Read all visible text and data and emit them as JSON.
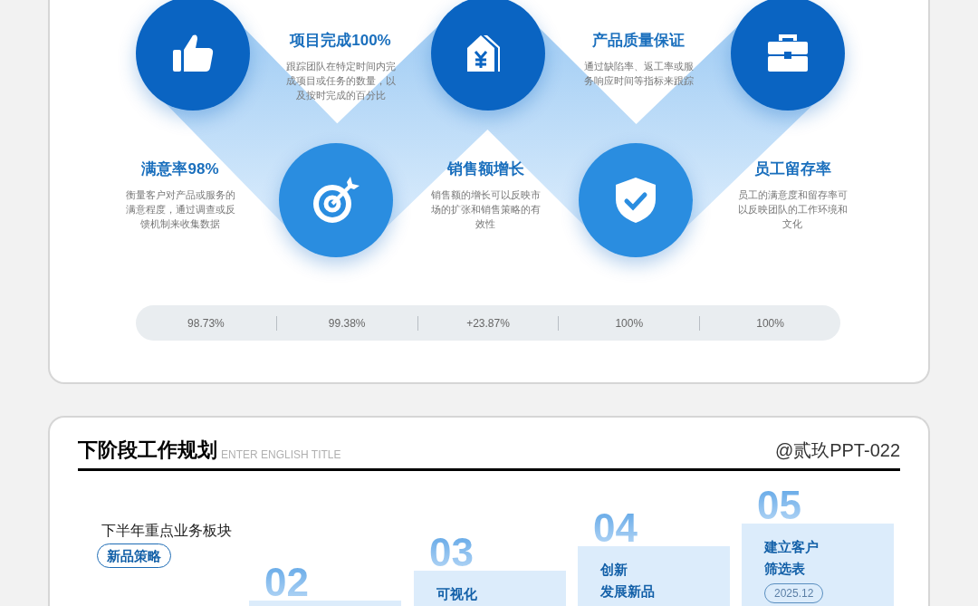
{
  "performance_slide": {
    "metrics": [
      {
        "title": "满意率98%",
        "description": "衡量客户对产品或服务的满意程度，通过调查或反馈机制来收集数据"
      },
      {
        "title": "项目完成100%",
        "description": "跟踪团队在特定时间内完成项目或任务的数量，以及按时完成的百分比"
      },
      {
        "title": "销售额增长",
        "description": "销售额的增长可以反映市场的扩张和销售策略的有效性"
      },
      {
        "title": "产品质量保证",
        "description": "通过缺陷率、返工率或服务响应时间等指标来跟踪"
      },
      {
        "title": "员工留存率",
        "description": "员工的满意度和留存率可以反映团队的工作环境和文化"
      }
    ],
    "stats": [
      "98.73%",
      "99.38%",
      "+23.87%",
      "100%",
      "100%"
    ]
  },
  "plan_slide": {
    "title": "下阶段工作规划",
    "subtitle": "ENTER ENGLISH TITLE",
    "author": "@贰玖PPT-022",
    "section_label": "下半年重点业务板块",
    "tag": "新品策略",
    "steps": [
      {
        "number": "02"
      },
      {
        "number": "03",
        "lines": [
          "可视化"
        ]
      },
      {
        "number": "04",
        "lines": [
          "创新",
          "发展新品"
        ]
      },
      {
        "number": "05",
        "lines": [
          "建立客户",
          "筛选表"
        ],
        "date": "2025.12"
      }
    ]
  }
}
